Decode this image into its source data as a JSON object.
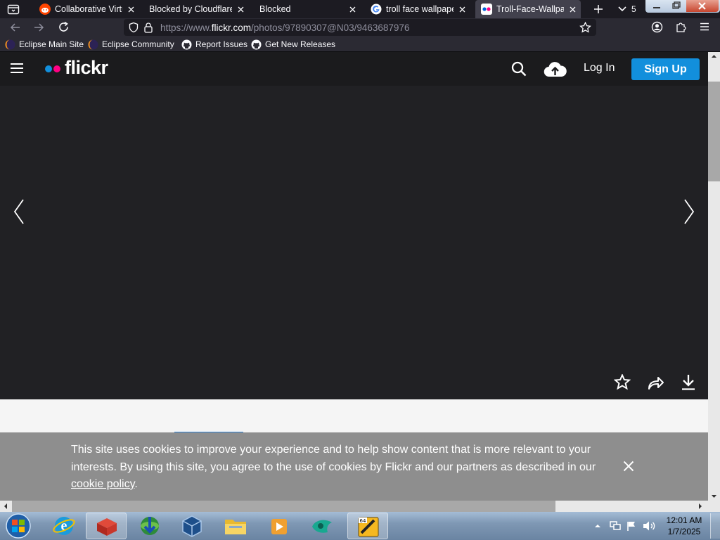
{
  "browser": {
    "tabs": [
      {
        "title": "Collaborative Virtu",
        "favicon": "reddit-icon"
      },
      {
        "title": "Blocked by Cloudflare (",
        "favicon": "none"
      },
      {
        "title": "Blocked",
        "favicon": "none"
      },
      {
        "title": "troll face wallpaper",
        "favicon": "google-icon"
      },
      {
        "title": "Troll-Face-Wallpap",
        "favicon": "flickr-icon",
        "active": true
      }
    ],
    "tab_overflow_count": "5",
    "url_scheme": "https://www.",
    "url_host": "flickr.com",
    "url_path": "/photos/97890307@N03/9463687976",
    "bookmarks": [
      {
        "label": "Eclipse Main Site",
        "icon": "eclipse-icon"
      },
      {
        "label": "Eclipse Community",
        "icon": "eclipse-icon"
      },
      {
        "label": "Report Issues",
        "icon": "github-icon"
      },
      {
        "label": "Get New Releases",
        "icon": "github-icon"
      }
    ]
  },
  "flickr": {
    "logo": "flickr",
    "login_label": "Log In",
    "signup_label": "Sign Up",
    "brand_blue": "#128fdc",
    "brand_pink": "#ff0084",
    "thumbnail_count": 7,
    "selected_thumbnail": 4
  },
  "cookie_banner": {
    "text": "This site uses cookies to improve your experience and to help show content that is more relevant to your interests. By using this site, you agree to the use of cookies by Flickr and our partners as described in our ",
    "link_text": "cookie policy",
    "suffix": "."
  },
  "taskbar": {
    "time": "12:01 AM",
    "date": "1/7/2025",
    "apps": [
      "start-orb-icon",
      "internet-explorer-icon",
      "red-cube-app-icon",
      "download-manager-icon",
      "virtualbox-icon",
      "file-explorer-icon",
      "media-player-icon",
      "green-app-icon",
      "app-64-icon"
    ]
  }
}
